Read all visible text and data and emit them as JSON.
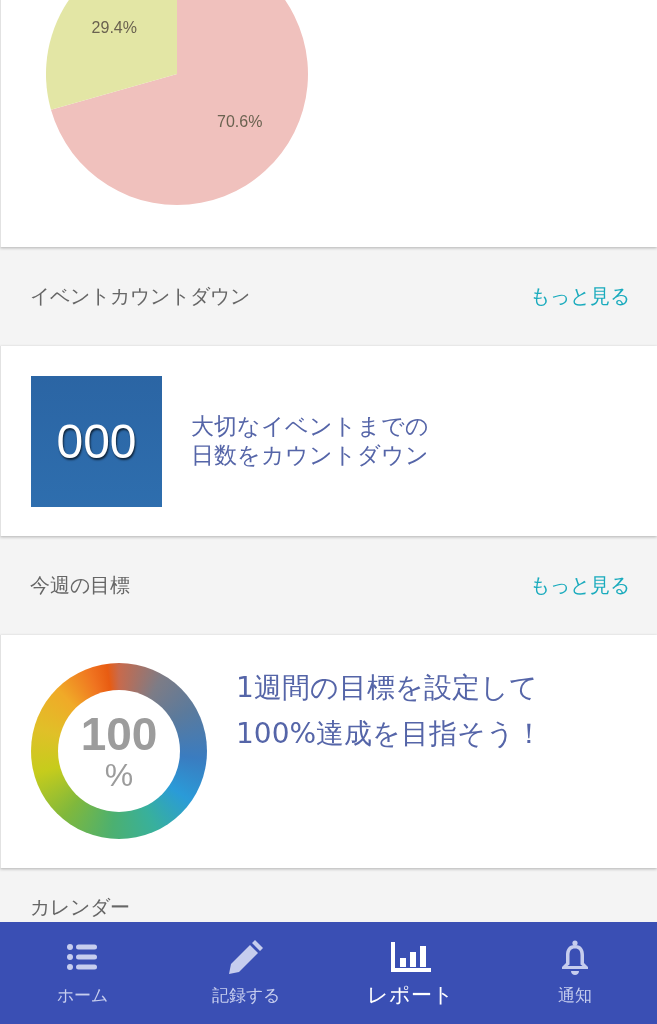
{
  "summary_card": {
    "chart_data": {
      "type": "pie",
      "values": [
        70.6,
        29.4
      ],
      "colors": [
        "#f0c1bd",
        "#e3e6a5"
      ],
      "value_labels": [
        "70.6%",
        "29.4%"
      ]
    }
  },
  "sections": [
    {
      "kind": "countdown",
      "title": "イベントカウントダウン",
      "more_link": "もっと見る",
      "tile_value": "000",
      "message": "大切なイベントまでの日数をカウントダウン"
    },
    {
      "kind": "goal",
      "title": "今週の目標",
      "more_link": "もっと見る",
      "ring_value": "100",
      "ring_unit": "%",
      "message": "1週間の目標を設定して100%達成を目指そう！"
    },
    {
      "kind": "calendar",
      "title": "カレンダー"
    }
  ],
  "bottom_nav": [
    {
      "kind": "home",
      "label": "ホーム",
      "selected": false
    },
    {
      "kind": "record",
      "label": "記録する",
      "selected": false
    },
    {
      "kind": "report",
      "label": "レポート",
      "selected": true
    },
    {
      "kind": "notifications",
      "label": "通知",
      "selected": false
    }
  ]
}
